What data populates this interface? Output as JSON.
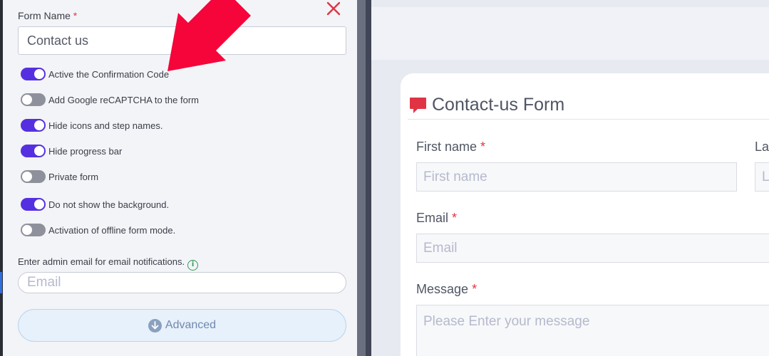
{
  "settings": {
    "form_name_label": "Form Name",
    "required_mark": "*",
    "form_name_value": "Contact us",
    "toggles": [
      {
        "label": "Active the Confirmation Code",
        "on": true
      },
      {
        "label": "Add Google reCAPTCHA to the form",
        "on": false
      },
      {
        "label": "Hide icons and step names.",
        "on": true
      },
      {
        "label": "Hide progress bar",
        "on": true
      },
      {
        "label": "Private form",
        "on": false
      },
      {
        "label": "Do not show the background.",
        "on": true
      },
      {
        "label": "Activation of offline form mode.",
        "on": false
      }
    ],
    "admin_email_label": "Enter admin email for email notifications.",
    "info_glyph": "i",
    "email_placeholder": "Email",
    "advanced_label": "Advanced"
  },
  "preview": {
    "title": "Contact-us Form",
    "first_name_label": "First name",
    "first_name_placeholder": "First name",
    "last_name_label_partial": "La",
    "last_name_placeholder_partial": "L",
    "email_label": "Email",
    "email_placeholder": "Email",
    "message_label": "Message",
    "message_placeholder": "Please Enter your message",
    "required_mark": "*"
  },
  "colors": {
    "toggle_on": "#5530e0",
    "toggle_off": "#8e909c",
    "required": "#e03444",
    "annotation_arrow": "#f5053a",
    "chat_icon": "#e03444"
  },
  "icons": {
    "close": "close-icon",
    "info": "info-icon",
    "advanced": "arrow-down-circle-icon",
    "title": "chat-bubble-icon"
  }
}
